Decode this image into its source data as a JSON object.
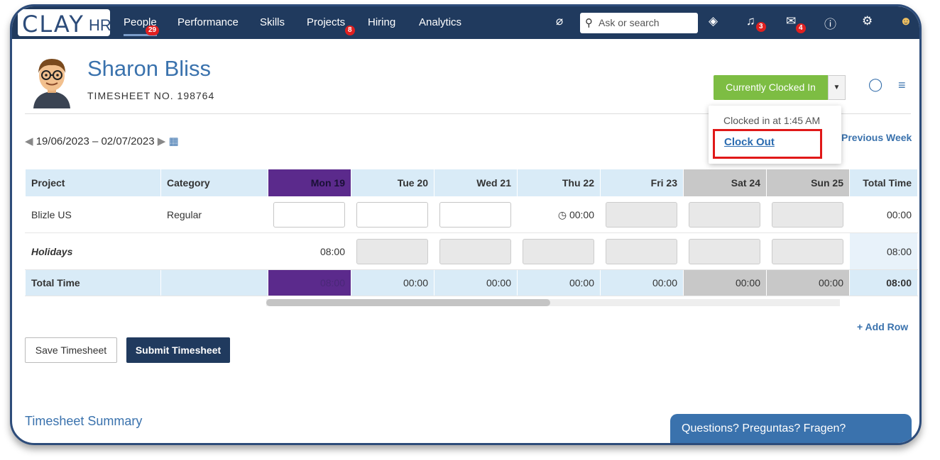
{
  "app": {
    "logo_main": "CLAY",
    "logo_sub": "HR"
  },
  "nav": {
    "items": [
      {
        "label": "People",
        "badge": "29"
      },
      {
        "label": "Performance"
      },
      {
        "label": "Skills"
      },
      {
        "label": "Projects",
        "badge": "8"
      },
      {
        "label": "Hiring"
      },
      {
        "label": "Analytics"
      }
    ],
    "search_placeholder": "Ask or search",
    "notifications_badge": "3",
    "messages_badge": "4"
  },
  "employee": {
    "name": "Sharon Bliss",
    "timesheet_no": "TIMESHEET NO. 198764"
  },
  "clock": {
    "button_label": "Currently Clocked In",
    "dropdown_text": "Clocked in at 1:45 AM",
    "clock_out_label": "Clock Out"
  },
  "date_range": "19/06/2023 – 02/07/2023",
  "previous_week_label": "Previous Week",
  "table": {
    "headers": [
      "Project",
      "Category",
      "Mon 19",
      "Tue 20",
      "Wed 21",
      "Thu 22",
      "Fri 23",
      "Sat 24",
      "Sun 25",
      "Total Time"
    ],
    "row1": {
      "project": "Blizle US",
      "category": "Regular",
      "thu": "00:00",
      "total": "00:00"
    },
    "row2": {
      "project": "Holidays",
      "mon": "08:00",
      "total": "08:00"
    },
    "totals": {
      "label": "Total Time",
      "mon": "08:00",
      "tue": "00:00",
      "wed": "00:00",
      "thu": "00:00",
      "fri": "00:00",
      "sat": "00:00",
      "sun": "00:00",
      "total": "08:00"
    }
  },
  "actions": {
    "add_row": "+ Add Row",
    "save": "Save Timesheet",
    "submit": "Submit Timesheet"
  },
  "summary_title": "Timesheet Summary",
  "chat_label": "Questions? Preguntas? Fragen?",
  "colors": {
    "nav_bg": "#203a5e",
    "accent_blue": "#3a72ad",
    "clock_green": "#7dbd43",
    "monday_purple": "#5b2a8c",
    "alert_red": "#e01818"
  }
}
